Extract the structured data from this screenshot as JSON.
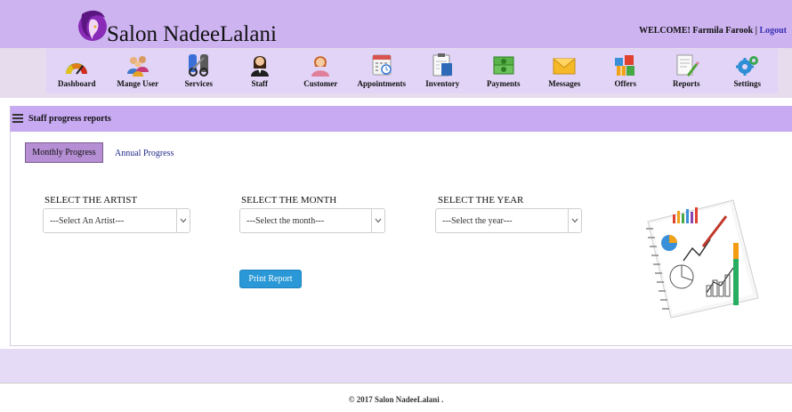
{
  "brand": {
    "name": "Salon NadeeLalani",
    "logo_icon": "woman-silhouette-logo-icon"
  },
  "header": {
    "welcome": "WELCOME! Farmila Farook",
    "separator": " | ",
    "logout": "Logout"
  },
  "nav": [
    {
      "label": "Dashboard",
      "icon": "gauge-icon"
    },
    {
      "label": "Mange User",
      "icon": "users-icon"
    },
    {
      "label": "Services",
      "icon": "scissors-icon"
    },
    {
      "label": "Staff",
      "icon": "staff-icon"
    },
    {
      "label": "Customer",
      "icon": "customer-icon"
    },
    {
      "label": "Appointments",
      "icon": "calendar-icon"
    },
    {
      "label": "Inventory",
      "icon": "clipboard-icon"
    },
    {
      "label": "Payments",
      "icon": "money-icon"
    },
    {
      "label": "Messages",
      "icon": "envelope-icon"
    },
    {
      "label": "Offers",
      "icon": "gift-icon"
    },
    {
      "label": "Reports",
      "icon": "report-icon"
    },
    {
      "label": "Settings",
      "icon": "gears-icon"
    }
  ],
  "panel": {
    "title": "Staff progress reports"
  },
  "tabs": {
    "monthly": "Monthly Progress",
    "annual": "Annual Progress"
  },
  "filters": {
    "artist": {
      "label": "SELECT THE ARTIST",
      "value": "---Select An Artist---"
    },
    "month": {
      "label": "SELECT THE MONTH",
      "value": "---Select the month---"
    },
    "year": {
      "label": "SELECT THE YEAR",
      "value": "---Select the year---"
    }
  },
  "print_button": "Print Report",
  "footer": "© 2017 Salon NadeeLalani .",
  "colors": {
    "header_bg": "#cdb3f0",
    "panel_head_bg": "#c8aaf2",
    "button": "#2a98d6",
    "active_tab": "#b58ed3"
  }
}
